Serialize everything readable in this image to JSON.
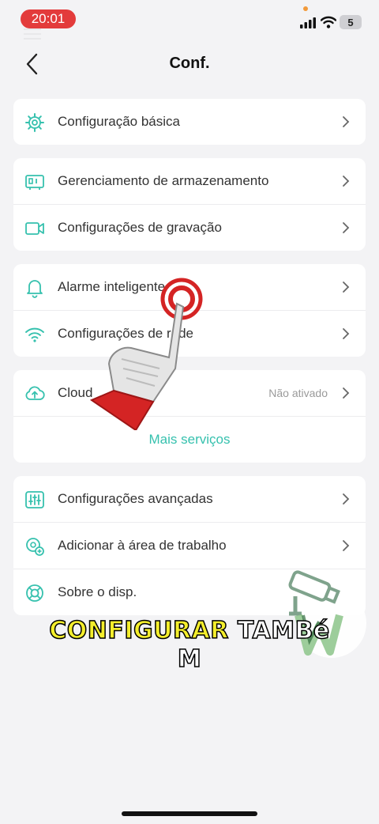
{
  "status_bar": {
    "time": "20:01",
    "battery": "5"
  },
  "header": {
    "title": "Conf."
  },
  "groups": [
    {
      "items": [
        {
          "icon": "basic-settings-gear-icon",
          "label": "Configuração básica"
        }
      ]
    },
    {
      "items": [
        {
          "icon": "storage-icon",
          "label": "Gerenciamento de armazenamento"
        },
        {
          "icon": "video-camera-icon",
          "label": "Configurações de gravação"
        }
      ]
    },
    {
      "items": [
        {
          "icon": "bell-icon",
          "label": "Alarme inteligente"
        },
        {
          "icon": "wifi-icon",
          "label": "Configurações de rede"
        }
      ]
    },
    {
      "items": [
        {
          "icon": "cloud-upload-icon",
          "label": "Cloud",
          "status": "Não ativado"
        }
      ],
      "more_label": "Mais serviços"
    },
    {
      "items": [
        {
          "icon": "sliders-icon",
          "label": "Configurações avançadas"
        },
        {
          "icon": "add-to-desktop-icon",
          "label": "Adicionar à área de trabalho"
        },
        {
          "icon": "lifebuoy-icon",
          "label": "Sobre o disp."
        }
      ]
    }
  ],
  "caption": {
    "highlight": "CONFIGURAR",
    "rest_line1": "TAMBé",
    "rest_line2": "M"
  },
  "colors": {
    "accent": "#36c1ae",
    "caption_highlight": "#f4ee2c",
    "time_pill": "#e33b3b",
    "background": "#f3f3f5"
  }
}
